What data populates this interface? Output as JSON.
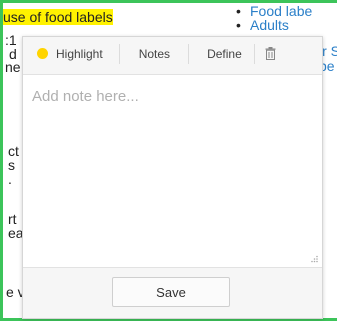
{
  "background": {
    "highlighted_heading": "use of food labels",
    "left_fragments": [
      ":1",
      "d",
      "ne",
      "ct",
      "s",
      ".",
      "rt",
      "ea",
      "e v"
    ],
    "right_list": [
      "Food labe",
      "Adults"
    ],
    "right_fragments": [
      "ir S",
      "be"
    ]
  },
  "popup": {
    "toolbar": {
      "highlight_label": "Highlight",
      "notes_label": "Notes",
      "define_label": "Define",
      "delete_icon": "trash-icon"
    },
    "note": {
      "placeholder": "Add note here...",
      "value": ""
    },
    "save_label": "Save"
  },
  "colors": {
    "frame_green": "#3cc45a",
    "highlight_yellow": "#fff200",
    "highlight_dot": "#ffd400",
    "link_blue": "#2a7fc8"
  }
}
